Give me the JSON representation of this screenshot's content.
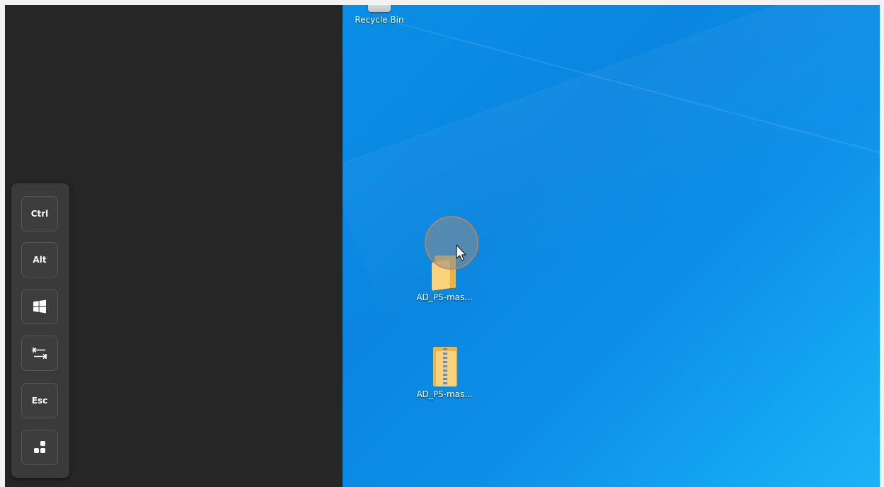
{
  "keys_panel": {
    "ctrl_label": "Ctrl",
    "alt_label": "Alt",
    "windows_icon": "windows-logo-icon",
    "tab_icon": "tab-arrows-icon",
    "esc_label": "Esc",
    "more_icon": "more-dots-icon"
  },
  "desktop": {
    "icons": [
      {
        "label": "Recycle Bin",
        "icon": "recycle-bin-icon"
      },
      {
        "label": "AD_PS-mas...",
        "icon": "folder-icon"
      },
      {
        "label": "AD_PS-mas...",
        "icon": "zip-folder-icon"
      }
    ]
  },
  "colors": {
    "desktop_blue": "#0a8ee6",
    "dark_pane": "#262626",
    "panel": "#3a3a3a",
    "folder_yellow": "#fbd27a"
  }
}
